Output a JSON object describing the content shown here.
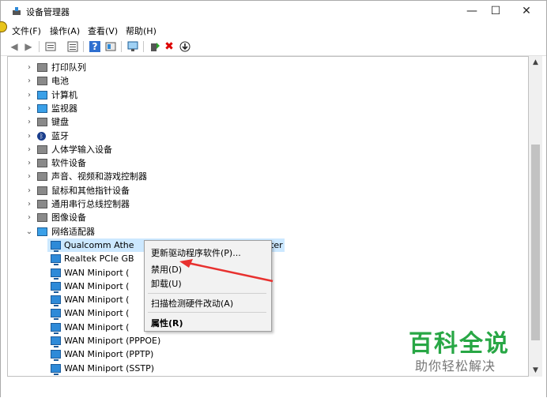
{
  "window": {
    "title": "设备管理器",
    "minimize_glyph": "—",
    "maximize_glyph": "☐",
    "close_glyph": "✕"
  },
  "menu": [
    "文件(F)",
    "操作(A)",
    "查看(V)",
    "帮助(H)"
  ],
  "toolbar": {
    "icons": [
      "back-icon",
      "forward-icon",
      "properties-view-icon",
      "list-view-icon",
      "help-icon",
      "show-hidden-icon",
      "scan-monitor-icon",
      "add-driver-icon",
      "uninstall-icon",
      "disable-icon"
    ]
  },
  "tree": {
    "categories": [
      {
        "label": "打印队列",
        "icon": "printer-icon",
        "expanded": false
      },
      {
        "label": "电池",
        "icon": "battery-icon",
        "expanded": false
      },
      {
        "label": "计算机",
        "icon": "computer-icon",
        "expanded": false
      },
      {
        "label": "监视器",
        "icon": "monitor-icon",
        "expanded": false
      },
      {
        "label": "键盘",
        "icon": "keyboard-icon",
        "expanded": false
      },
      {
        "label": "蓝牙",
        "icon": "bluetooth-icon",
        "expanded": false
      },
      {
        "label": "人体学输入设备",
        "icon": "hid-icon",
        "expanded": false
      },
      {
        "label": "软件设备",
        "icon": "software-device-icon",
        "expanded": false
      },
      {
        "label": "声音、视频和游戏控制器",
        "icon": "speaker-icon",
        "expanded": false
      },
      {
        "label": "鼠标和其他指针设备",
        "icon": "mouse-icon",
        "expanded": false
      },
      {
        "label": "通用串行总线控制器",
        "icon": "usb-icon",
        "expanded": false
      },
      {
        "label": "图像设备",
        "icon": "camera-icon",
        "expanded": false
      },
      {
        "label": "网络适配器",
        "icon": "network-adapter-icon",
        "expanded": true
      }
    ],
    "network_adapters": [
      {
        "label": "Qualcomm Athe",
        "label_tail": "ter",
        "selected": true
      },
      {
        "label": "Realtek PCIe GB"
      },
      {
        "label": "WAN Miniport ("
      },
      {
        "label": "WAN Miniport ("
      },
      {
        "label": "WAN Miniport ("
      },
      {
        "label": "WAN Miniport ("
      },
      {
        "label": "WAN Miniport ("
      },
      {
        "label": "WAN Miniport (PPPOE)"
      },
      {
        "label": "WAN Miniport (PPTP)"
      },
      {
        "label": "WAN Miniport (SSTP)"
      }
    ]
  },
  "context_menu": {
    "items": [
      "更新驱动程序软件(P)...",
      "禁用(D)",
      "卸载(U)",
      "扫描检测硬件改动(A)",
      "属性(R)"
    ]
  },
  "annotation": {
    "arrow_color": "#e8312f"
  },
  "watermark": {
    "title": "百科全说",
    "subtitle": "助你轻松解决"
  },
  "scrollbar": {
    "up": "▲",
    "down": "▼"
  }
}
